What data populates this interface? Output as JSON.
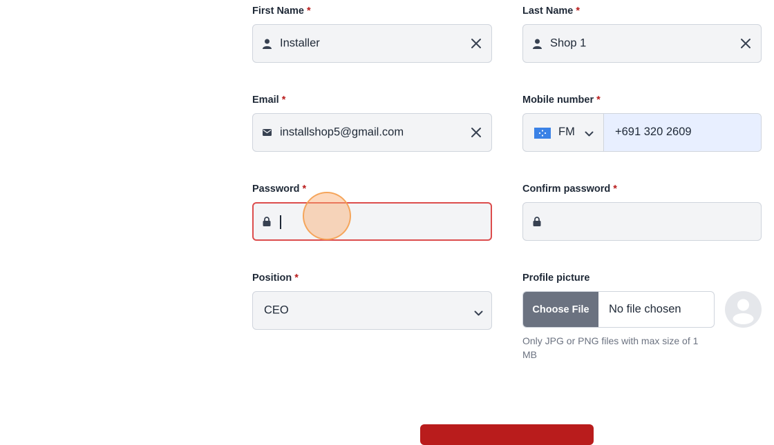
{
  "form": {
    "required_mark": "*",
    "first_name": {
      "label": "First Name",
      "value": "Installer"
    },
    "last_name": {
      "label": "Last Name",
      "value": "Shop 1"
    },
    "email": {
      "label": "Email",
      "value": "installshop5@gmail.com"
    },
    "mobile": {
      "label": "Mobile number",
      "country_code": "FM",
      "value": "+691 320 2609"
    },
    "password": {
      "label": "Password",
      "value": ""
    },
    "confirm_password": {
      "label": "Confirm password",
      "value": ""
    },
    "position": {
      "label": "Position",
      "selected": "CEO"
    },
    "profile_picture": {
      "label": "Profile picture",
      "button": "Choose File",
      "status": "No file chosen",
      "hint": "Only JPG or PNG files with max size of 1 MB"
    }
  },
  "icons": {
    "person": "person-icon",
    "mail": "mail-icon",
    "lock": "lock-icon",
    "clear": "close-icon",
    "chevron": "chevron-down-icon",
    "flag": "flag-icon"
  },
  "colors": {
    "required": "#b91c1c",
    "error_border": "#dc4c4c",
    "submit": "#b91c1c",
    "phone_bg": "#e8efff"
  }
}
